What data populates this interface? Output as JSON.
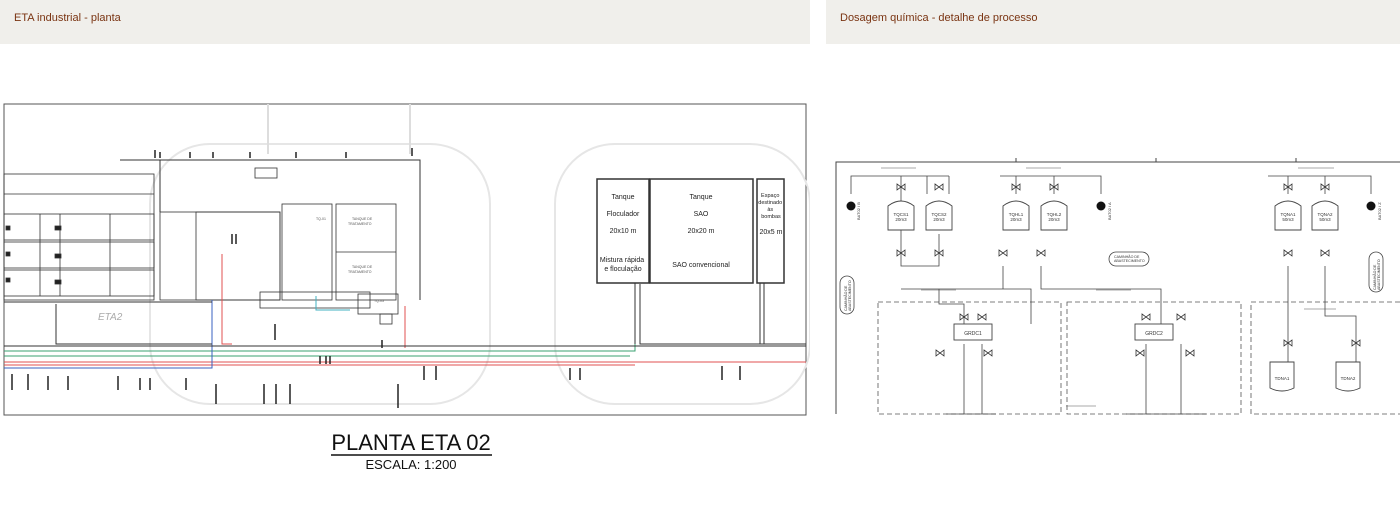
{
  "panels": {
    "left": {
      "title": "ETA industrial - planta",
      "drawing": {
        "plan_label": "ETA2",
        "main_title": "PLANTA ETA 02",
        "scale": "ESCALA: 1:200",
        "tanks": [
          {
            "heading": "Tanque",
            "name": "Floculador",
            "size": "20x10 m",
            "note": "Mistura rápida\ne floculação"
          },
          {
            "heading": "Tanque",
            "name": "SAO",
            "size": "20x20 m",
            "note": "SAO convencional"
          }
        ],
        "reserved_space": {
          "label": "Espaço\ndestinado\nàs\nbombas",
          "size": "20x5 m"
        }
      }
    },
    "right": {
      "title": "Dosagem química - detalhe de processo",
      "drawing": {
        "tanks_top": [
          "TQCS1\n20m3",
          "TQCS2\n20m3",
          "TQHL1\n20m3",
          "TQHL2\n20m3",
          "TQNA1\n50m3",
          "TQNA2\n50m3"
        ],
        "dosing_units": [
          "GRDC1",
          "GRDC2"
        ],
        "drums": [
          "TDNA1",
          "TDNA2"
        ],
        "truck_labels": [
          "CAMINHÃO DE\nABASTECIMENTO",
          "CAMINHÃO DE\nABASTECIMENTO",
          "CAMINHÃO DE\nABASTECIMENTO"
        ],
        "pumps": [
          "BAT02 / B",
          "BAT02 / A",
          "BAT02 / Z"
        ]
      }
    }
  },
  "colors": {
    "header_bg": "#f0efeb",
    "title_text": "#7a3412",
    "line_dark": "#222222",
    "pipe_red": "#e05050",
    "pipe_green": "#3aa070",
    "pipe_blue": "#3a60c0",
    "pipe_cyan": "#40b0c0"
  }
}
